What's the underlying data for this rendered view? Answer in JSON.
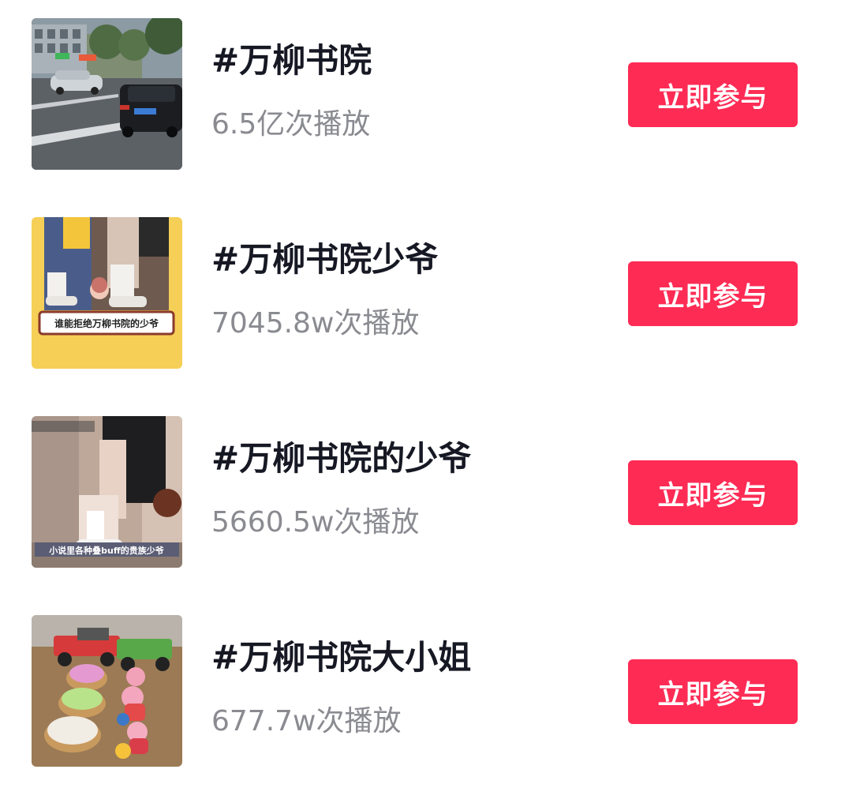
{
  "topics": [
    {
      "title": "#万柳书院",
      "plays": "6.5亿次播放",
      "button": "立即参与",
      "thumb_caption": ""
    },
    {
      "title": "#万柳书院少爷",
      "plays": "7045.8w次播放",
      "button": "立即参与",
      "thumb_caption": "谁能拒绝万柳书院的少爷"
    },
    {
      "title": "#万柳书院的少爷",
      "plays": "5660.5w次播放",
      "button": "立即参与",
      "thumb_caption": "小说里各种叠buff的贵族少爷"
    },
    {
      "title": "#万柳书院大小姐",
      "plays": "677.7w次播放",
      "button": "立即参与",
      "thumb_caption": ""
    }
  ],
  "colors": {
    "button_bg": "#fe2c55",
    "title": "#161823",
    "subtitle": "#8a8b91"
  }
}
